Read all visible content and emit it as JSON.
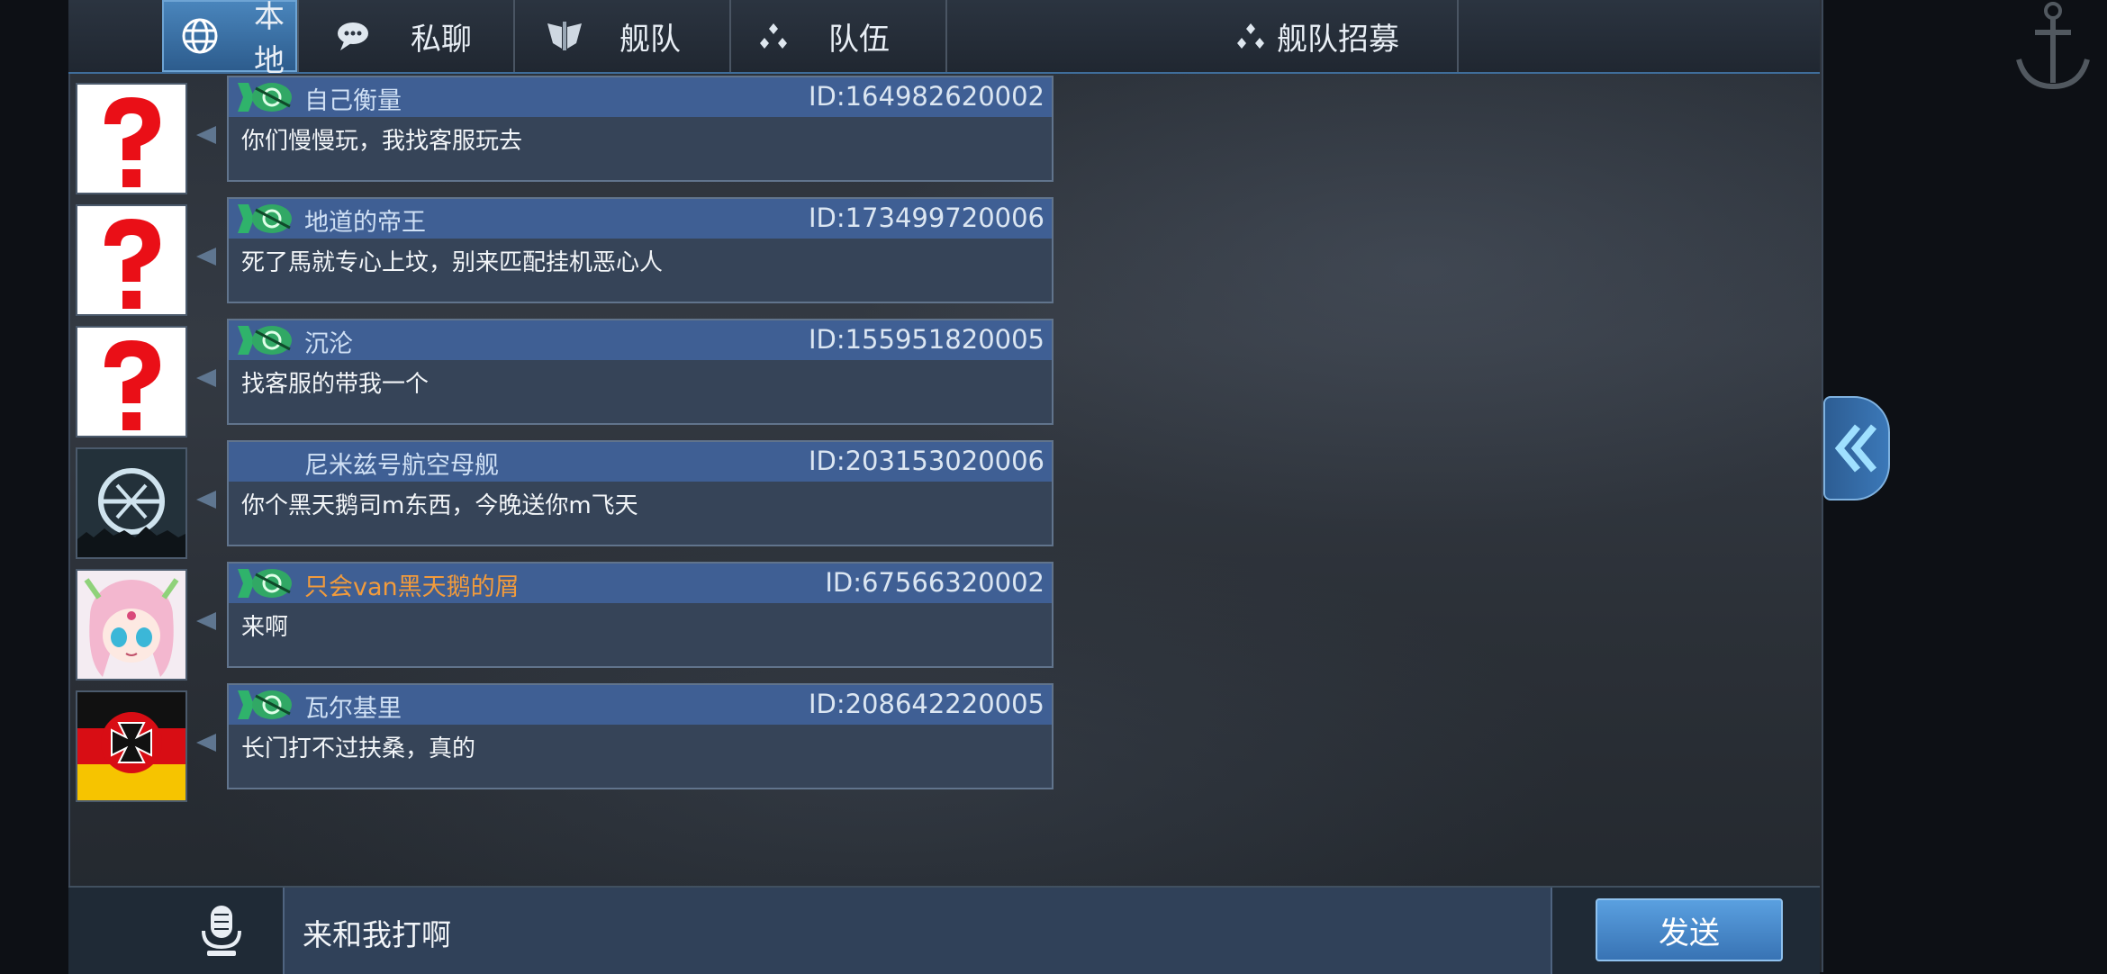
{
  "tabs": [
    {
      "label": "本地",
      "icon": "globe-icon",
      "active": true
    },
    {
      "label": "私聊",
      "icon": "chat-bubbles-icon",
      "active": false
    },
    {
      "label": "舰队",
      "icon": "fleet-emblem-icon",
      "active": false
    },
    {
      "label": "队伍",
      "icon": "team-dots-icon",
      "active": false
    },
    {
      "label": "舰队招募",
      "icon": "team-dots-icon",
      "active": false
    }
  ],
  "messages": [
    {
      "name": "自己衡量",
      "id": "ID:164982620002",
      "text": "你们慢慢玩，我找客服玩去",
      "avatar": "question-mark-avatar"
    },
    {
      "name": "地道的帝王",
      "id": "ID:173499720006",
      "text": "死了馬就专心上坟，别来匹配挂机恶心人",
      "avatar": "question-mark-avatar"
    },
    {
      "name": "沉沦",
      "id": "ID:155951820005",
      "text": "找客服的带我一个",
      "avatar": "question-mark-avatar"
    },
    {
      "name": "尼米兹号航空母舰",
      "id": "ID:203153020006",
      "text": "你个黑天鹅司m东西，今晚送你m飞天",
      "avatar": "emblem-avatar"
    },
    {
      "name": "只会van黑天鹅的屑",
      "id": "ID:67566320002",
      "text": "来啊",
      "avatar": "anime-girl-avatar"
    },
    {
      "name": "瓦尔基里",
      "id": "ID:208642220005",
      "text": "长门打不过扶桑，真的",
      "avatar": "iron-cross-flag-avatar"
    }
  ],
  "input": {
    "value": "来和我打啊"
  },
  "send_label": "发送",
  "colors": {
    "accent": "#3f75b3",
    "name_highlight": "#f29b3c",
    "bubble": "#364458"
  }
}
